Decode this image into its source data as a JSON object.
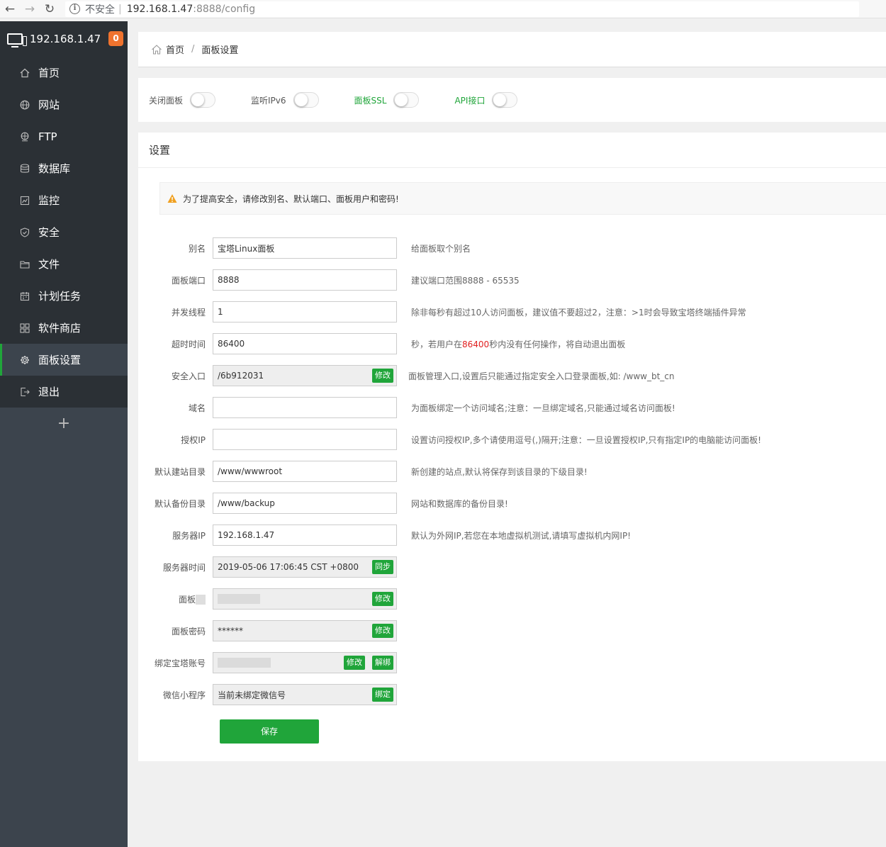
{
  "browser": {
    "back": "←",
    "forward": "→",
    "reload": "↻",
    "insecure_label": "不安全",
    "host": "192.168.1.47",
    "path": ":8888/config"
  },
  "sidebar": {
    "ip": "192.168.1.47",
    "badge": "0",
    "items": [
      {
        "label": "首页",
        "icon": "home-icon"
      },
      {
        "label": "网站",
        "icon": "globe-icon"
      },
      {
        "label": "FTP",
        "icon": "ftp-icon"
      },
      {
        "label": "数据库",
        "icon": "database-icon"
      },
      {
        "label": "监控",
        "icon": "monitor-chart-icon"
      },
      {
        "label": "安全",
        "icon": "shield-icon"
      },
      {
        "label": "文件",
        "icon": "folder-icon"
      },
      {
        "label": "计划任务",
        "icon": "calendar-icon"
      },
      {
        "label": "软件商店",
        "icon": "grid-icon"
      },
      {
        "label": "面板设置",
        "icon": "gear-icon"
      },
      {
        "label": "退出",
        "icon": "logout-icon"
      }
    ],
    "add_label": "+",
    "active_index": 9
  },
  "breadcrumb": {
    "home": "首页",
    "separator": "/",
    "current": "面板设置"
  },
  "switches": [
    {
      "label": "关闭面板",
      "on": false,
      "green": false
    },
    {
      "label": "监听IPv6",
      "on": false,
      "green": false
    },
    {
      "label": "面板SSL",
      "on": false,
      "green": true
    },
    {
      "label": "API接口",
      "on": false,
      "green": true
    }
  ],
  "settings": {
    "title": "设置",
    "alert": "为了提高安全，请修改别名、默认端口、面板用户和密码!",
    "rows": {
      "alias": {
        "label": "别名",
        "value": "宝塔Linux面板",
        "hint": "给面板取个别名"
      },
      "port": {
        "label": "面板端口",
        "value": "8888",
        "hint": "建议端口范围8888 - 65535"
      },
      "threads": {
        "label": "并发线程",
        "value": "1",
        "hint": "除非每秒有超过10人访问面板，建议值不要超过2，注意：>1时会导致宝塔终端插件异常"
      },
      "timeout": {
        "label": "超时时间",
        "value": "86400",
        "hint_pre": "秒，若用户在",
        "hint_num": "86400",
        "hint_post": "秒内没有任何操作，将自动退出面板"
      },
      "entry": {
        "label": "安全入口",
        "value": "/6b912031",
        "button": "修改",
        "hint": "面板管理入口,设置后只能通过指定安全入口登录面板,如: /www_bt_cn"
      },
      "domain": {
        "label": "域名",
        "value": "",
        "hint": "为面板绑定一个访问域名;注意：一旦绑定域名,只能通过域名访问面板!"
      },
      "auth_ip": {
        "label": "授权IP",
        "value": "",
        "hint": "设置访问授权IP,多个请使用逗号(,)隔开;注意：一旦设置授权IP,只有指定IP的电脑能访问面板!"
      },
      "site_dir": {
        "label": "默认建站目录",
        "value": "/www/wwwroot",
        "hint": "新创建的站点,默认将保存到该目录的下级目录!"
      },
      "backup_dir": {
        "label": "默认备份目录",
        "value": "/www/backup",
        "hint": "网站和数据库的备份目录!"
      },
      "server_ip": {
        "label": "服务器IP",
        "value": "192.168.1.47",
        "hint": "默认为外网IP,若您在本地虚拟机测试,请填写虚拟机内网IP!"
      },
      "server_time": {
        "label": "服务器时间",
        "value": "2019-05-06 17:06:45 CST +0800",
        "button": "同步"
      },
      "panel_user": {
        "label": "面板",
        "value": "",
        "button": "修改"
      },
      "panel_pass": {
        "label": "面板密码",
        "value": "******",
        "button": "修改"
      },
      "bt_account": {
        "label": "绑定宝塔账号",
        "value": "",
        "button1": "修改",
        "button2": "解绑"
      },
      "wechat": {
        "label": "微信小程序",
        "value": "当前未绑定微信号",
        "button": "绑定"
      }
    },
    "save": "保存"
  },
  "colors": {
    "accent": "#20a53a",
    "sidebar": "#3c444d",
    "sidebar_dark": "#2b3035",
    "badge": "#f0732e"
  }
}
